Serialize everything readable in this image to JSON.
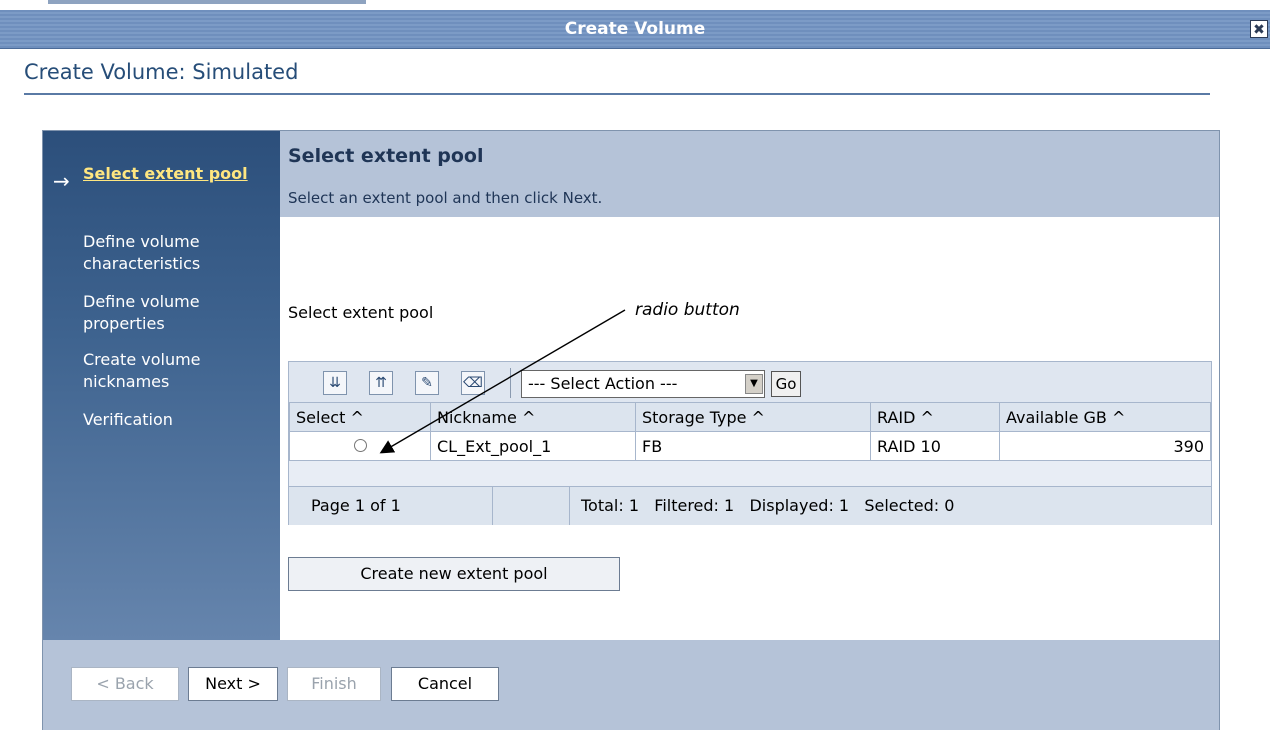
{
  "window": {
    "title": "Create Volume",
    "close_glyph": "✖"
  },
  "page": {
    "title": "Create Volume: Simulated"
  },
  "sidebar": {
    "items": [
      {
        "label": "Select extent pool"
      },
      {
        "label": "Define volume characteristics"
      },
      {
        "label": "Define volume properties"
      },
      {
        "label": "Create volume nicknames"
      },
      {
        "label": "Verification"
      }
    ]
  },
  "header": {
    "title": "Select extent pool",
    "subtitle": "Select an extent pool and then click Next."
  },
  "main": {
    "section_label": "Select extent pool",
    "annotation": "radio button",
    "action_select": "--- Select Action ---",
    "go_label": "Go",
    "columns": [
      "Select ^",
      "Nickname ^",
      "Storage Type ^",
      "RAID ^",
      "Available GB ^"
    ],
    "rows": [
      {
        "nickname": "CL_Ext_pool_1",
        "storage_type": "FB",
        "raid": "RAID 10",
        "available_gb": "390"
      }
    ],
    "pager": {
      "page": "Page 1 of 1",
      "totals": "Total: 1   Filtered: 1   Displayed: 1   Selected: 0"
    },
    "create_button": "Create new extent pool"
  },
  "footer": {
    "back": "< Back",
    "next": "Next >",
    "finish": "Finish",
    "cancel": "Cancel"
  }
}
